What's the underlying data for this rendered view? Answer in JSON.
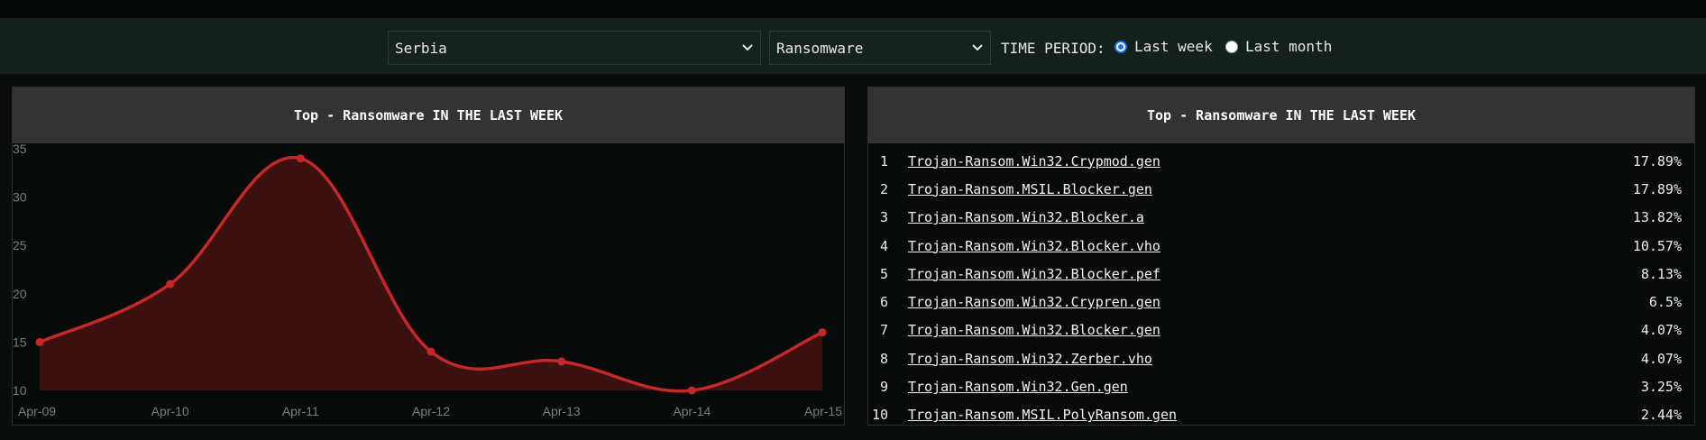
{
  "filters": {
    "country": "Serbia",
    "category": "Ransomware",
    "period_label": "TIME PERIOD:",
    "period_options": [
      {
        "label": "Last week",
        "checked": true
      },
      {
        "label": "Last month",
        "checked": false
      }
    ]
  },
  "chart_panel": {
    "title": "Top - Ransomware IN THE LAST WEEK"
  },
  "list_panel": {
    "title": "Top - Ransomware IN THE LAST WEEK",
    "items": [
      {
        "rank": "1",
        "name": "Trojan-Ransom.Win32.Crypmod.gen",
        "pct": "17.89%"
      },
      {
        "rank": "2",
        "name": "Trojan-Ransom.MSIL.Blocker.gen",
        "pct": "17.89%"
      },
      {
        "rank": "3",
        "name": "Trojan-Ransom.Win32.Blocker.a",
        "pct": "13.82%"
      },
      {
        "rank": "4",
        "name": "Trojan-Ransom.Win32.Blocker.vho",
        "pct": "10.57%"
      },
      {
        "rank": "5",
        "name": "Trojan-Ransom.Win32.Blocker.pef",
        "pct": "8.13%"
      },
      {
        "rank": "6",
        "name": "Trojan-Ransom.Win32.Crypren.gen",
        "pct": "6.5%"
      },
      {
        "rank": "7",
        "name": "Trojan-Ransom.Win32.Blocker.gen",
        "pct": "4.07%"
      },
      {
        "rank": "8",
        "name": "Trojan-Ransom.Win32.Zerber.vho",
        "pct": "4.07%"
      },
      {
        "rank": "9",
        "name": "Trojan-Ransom.Win32.Gen.gen",
        "pct": "3.25%"
      },
      {
        "rank": "10",
        "name": "Trojan-Ransom.MSIL.PolyRansom.gen",
        "pct": "2.44%"
      }
    ]
  },
  "colors": {
    "line": "#c62828",
    "fill": "#3a1110",
    "accent_radio": "#1a73e8"
  },
  "chart_data": {
    "type": "area",
    "title": "",
    "xlabel": "",
    "ylabel": "",
    "categories": [
      "Apr-09",
      "Apr-10",
      "Apr-11",
      "Apr-12",
      "Apr-13",
      "Apr-14",
      "Apr-15"
    ],
    "values": [
      15,
      21,
      34,
      14,
      13,
      10,
      16
    ],
    "y_ticks": [
      10,
      15,
      20,
      25,
      30,
      35
    ],
    "ylim": [
      10,
      35
    ],
    "grid": false,
    "smooth": true
  }
}
